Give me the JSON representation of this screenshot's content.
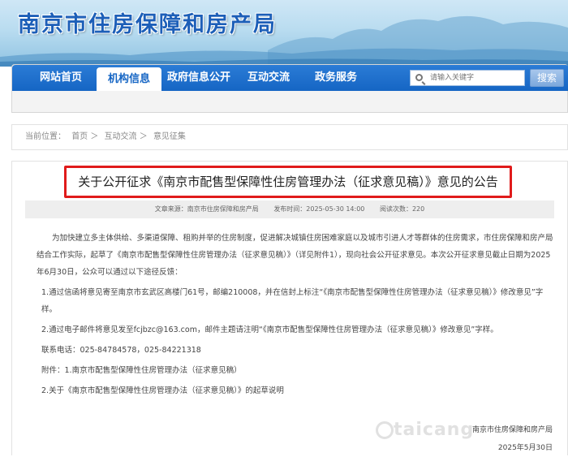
{
  "site": {
    "title": "南京市住房保障和房产局"
  },
  "nav": {
    "items": [
      {
        "label": "网站首页"
      },
      {
        "label": "机构信息"
      },
      {
        "label": "政府信息公开"
      },
      {
        "label": "互动交流"
      },
      {
        "label": "政务服务"
      }
    ],
    "active_index": 1,
    "search_placeholder": "请输入关键字",
    "search_button": "搜索"
  },
  "breadcrumb": {
    "prefix": "当前位置：",
    "items": [
      "首页",
      "互动交流",
      "意见征集"
    ],
    "separator": "＞"
  },
  "article": {
    "title": "关于公开征求《南京市配售型保障性住房管理办法（征求意见稿）》意见的公告",
    "meta": {
      "source": "文章来源：南京市住房保障和房产局",
      "published": "发布时间：2025-05-30 14:00",
      "views": "阅读次数：220"
    },
    "intro": "为加快建立多主体供给、多渠道保障、租购并举的住房制度，促进解决城镇住房困难家庭以及城市引进人才等群体的住房需求，市住房保障和房产局结合工作实际，起草了《南京市配售型保障性住房管理办法（征求意见稿）》（详见附件1），现向社会公开征求意见。本次公开征求意见截止日期为2025年6月30日，公众可以通过以下途径反馈：",
    "item1": "1.通过信函将意见寄至南京市玄武区高楼门61号，邮编210008，并在信封上标注“《南京市配售型保障性住房管理办法（征求意见稿）》修改意见”字样。",
    "item2": "2.通过电子邮件将意见发至fcjbzc@163.com，邮件主题请注明“《南京市配售型保障性住房管理办法（征求意见稿）》修改意见”字样。",
    "phone": "联系电话：025-84784578，025-84221318",
    "attachments": [
      "附件：1.南京市配售型保障性住房管理办法（征求意见稿）",
      "2.关于《南京市配售型保障性住房管理办法（征求意见稿）》的起草说明"
    ],
    "sign_org": "南京市住房保障和房产局",
    "sign_date": "2025年5月30日"
  },
  "watermark": "taicang",
  "colors": {
    "nav_blue": "#1565c4",
    "title_border_red": "#e01b1b",
    "site_title_blue": "#1d5fb8"
  }
}
